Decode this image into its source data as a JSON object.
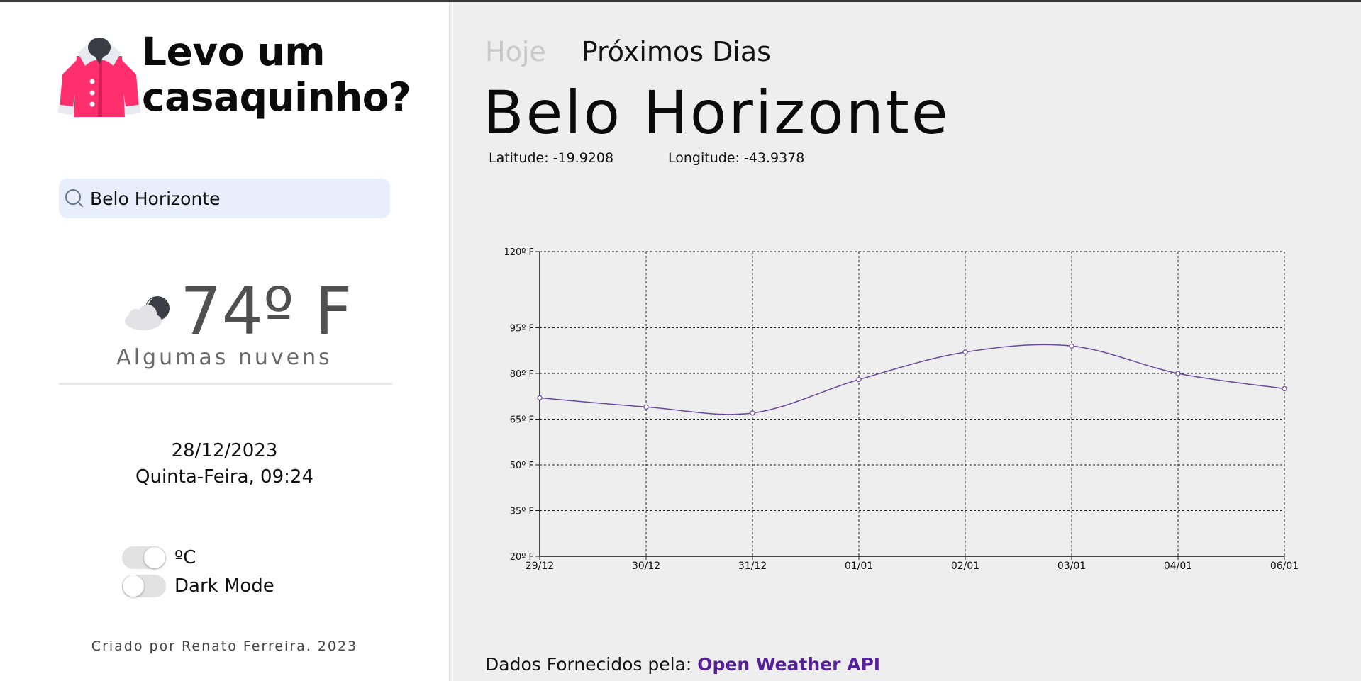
{
  "app": {
    "title": "Levo um\ncasaquinho?",
    "logo_icon": "pink-coat-icon",
    "accent_color": "#ff2e6c"
  },
  "search": {
    "value": "Belo Horizonte",
    "icon": "search-icon"
  },
  "current": {
    "temperature": "74º F",
    "description": "Algumas nuvens",
    "icon": "cloud-moon-icon",
    "date": "28/12/2023",
    "day_time": "Quinta-Feira, 09:24"
  },
  "toggles": [
    {
      "label": "ºC",
      "on": true
    },
    {
      "label": "Dark Mode",
      "on": false
    }
  ],
  "credits": "Criado por Renato Ferreira. 2023",
  "tabs": [
    {
      "label": "Hoje",
      "active": false
    },
    {
      "label": "Próximos Dias",
      "active": true
    }
  ],
  "city": {
    "name": "Belo Horizonte",
    "latitude": "Latitude: -19.9208",
    "longitude": "Longitude: -43.9378"
  },
  "footer": {
    "prefix": "Dados Fornecidos pela: ",
    "link_label": "Open Weather API",
    "link_color": "#55209a"
  },
  "chart_data": {
    "type": "line",
    "categories": [
      "29/12",
      "30/12",
      "31/12",
      "01/01",
      "02/01",
      "03/01",
      "04/01",
      "06/01"
    ],
    "series": [
      {
        "values": [
          72,
          69,
          67,
          78,
          87,
          89,
          80,
          75
        ],
        "color": "#6a4c9c"
      }
    ],
    "y_ticks": [
      20,
      35,
      50,
      65,
      80,
      95,
      120
    ],
    "y_tick_labels": [
      "20º F",
      "35º F",
      "50º F",
      "65º F",
      "80º F",
      "95º F",
      "120º F"
    ],
    "ylim": [
      20,
      120
    ],
    "grid": true,
    "grid_style": "dotted"
  }
}
